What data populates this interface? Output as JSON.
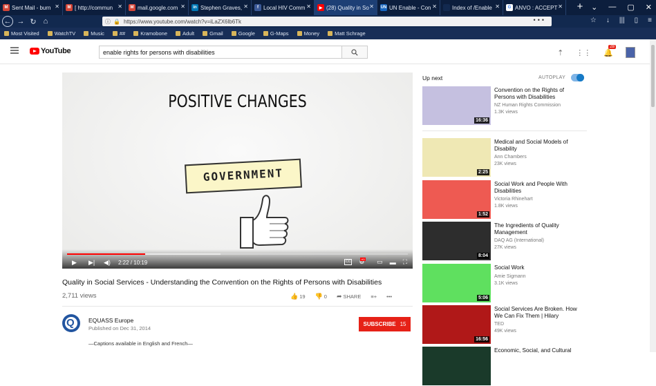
{
  "browser": {
    "tabs": [
      {
        "title": "Sent Mail - burn",
        "icon_color": "#d44638",
        "icon_letter": "M"
      },
      {
        "title": "[ http://commun",
        "icon_color": "#d44638",
        "icon_letter": "M"
      },
      {
        "title": "mail.google.com",
        "icon_color": "#d44638",
        "icon_letter": "M"
      },
      {
        "title": "Stephen Graves,",
        "icon_color": "#0077b5",
        "icon_letter": "in"
      },
      {
        "title": "Local HIV Comm",
        "icon_color": "#3b5998",
        "icon_letter": "f"
      },
      {
        "title": "(28) Quality in So",
        "icon_color": "#ff0000",
        "icon_letter": "▶"
      },
      {
        "title": "UN Enable - Con",
        "icon_color": "#1565c0",
        "icon_letter": "UN"
      },
      {
        "title": "Index of /Enable",
        "icon_color": "#12294f",
        "icon_letter": ""
      },
      {
        "title": "ANVO : ACCEPT",
        "icon_color": "#ffffff",
        "icon_letter": "G"
      }
    ],
    "active_tab": 5,
    "new_tab": "+",
    "url": "https://www.youtube.com/watch?v=iLaZX6lb6Tk",
    "url_menu": "•••",
    "bookmarks": [
      "Most Visited",
      "WatchTV",
      "Music",
      "##",
      "Kramobone",
      "Adult",
      "Gmail",
      "Google",
      "G-Maps",
      "Money",
      "Matt Schrage"
    ]
  },
  "youtube": {
    "logo_text": "YouTube",
    "search_value": "enable rights for persons with disabilities",
    "notification_count": "28"
  },
  "video": {
    "title": "Quality in Social Services - Understanding the Convention on the Rights of Persons with Disabilities",
    "views": "2,711 views",
    "likes": "19",
    "dislikes": "0",
    "share_label": "SHARE",
    "current_time": "2:22 / 10:19",
    "progress_fraction": 0.23,
    "buffer_fraction": 0.45,
    "frame_title": "POSITIVE CHANGES",
    "frame_sign": "GOVERNMENT"
  },
  "channel": {
    "name": "EQUASS Europe",
    "published": "Published on Dec 31, 2014",
    "subscribe_label": "SUBSCRIBE",
    "subscriber_count": "15",
    "description": "—Captions available in English and French—"
  },
  "sidebar": {
    "upnext_label": "Up next",
    "autoplay_label": "AUTOPLAY",
    "autoplay_on": true,
    "recommendations": [
      {
        "title": "Convention on the Rights of Persons with Disabilities",
        "channel": "NZ Human Rights Commission",
        "views": "1.3K views",
        "duration": "16:36",
        "thumb_color": "#c5c0e0"
      },
      {
        "title": "Medical and Social Models of Disability",
        "channel": "Ann Chambers",
        "views": "23K views",
        "duration": "2:25",
        "thumb_color": "#efe8b4"
      },
      {
        "title": "Social Work and People With Disabilities",
        "channel": "Victoria Rhinehart",
        "views": "1.8K views",
        "duration": "1:52",
        "thumb_color": "#ee5a52"
      },
      {
        "title": "The Ingredients of Quality Management",
        "channel": "DAQ AG (International)",
        "views": "27K views",
        "duration": "8:04",
        "thumb_color": "#2d2d2d"
      },
      {
        "title": "Social Work",
        "channel": "Amie Sigmann",
        "views": "3.1K views",
        "duration": "5:06",
        "thumb_color": "#5fe05f"
      },
      {
        "title": "Social Services Are Broken. How We Can Fix Them | Hilary",
        "channel": "TED",
        "views": "49K views",
        "duration": "16:56",
        "thumb_color": "#b01818"
      },
      {
        "title": "Economic, Social, and Cultural",
        "channel": "",
        "views": "",
        "duration": "",
        "thumb_color": "#1a3a2a"
      }
    ]
  }
}
